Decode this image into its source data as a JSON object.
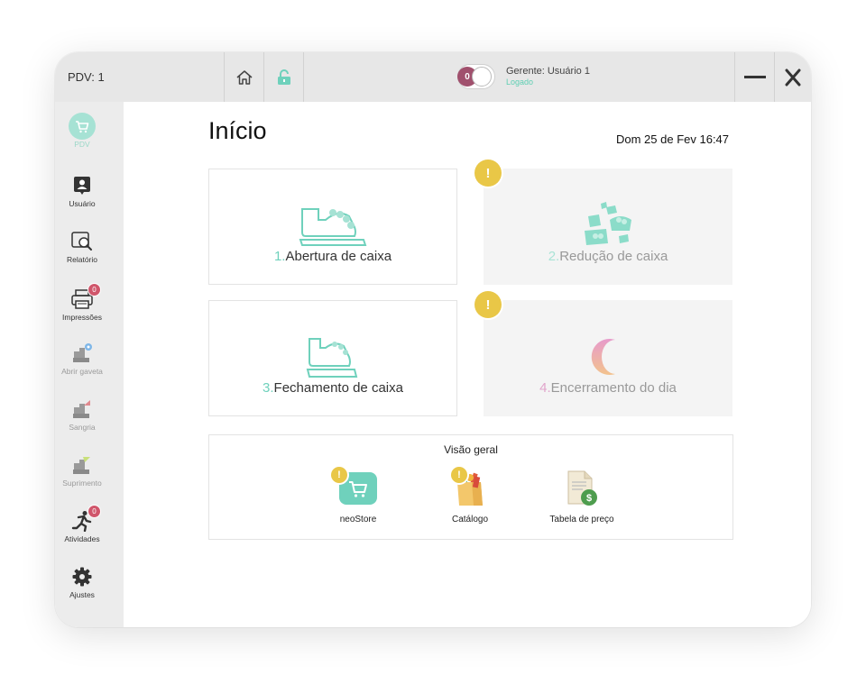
{
  "topbar": {
    "pdv_label": "PDV: 1",
    "toggle_count": "0",
    "user_name": "Gerente: Usuário 1",
    "user_status": "Logado"
  },
  "sidebar": {
    "items": [
      {
        "label": "PDV"
      },
      {
        "label": "Usuário"
      },
      {
        "label": "Relatório"
      },
      {
        "label": "Impressões",
        "badge": "0"
      },
      {
        "label": "Abrir gaveta"
      },
      {
        "label": "Sangria"
      },
      {
        "label": "Suprimento"
      },
      {
        "label": "Atividades",
        "badge": "0"
      },
      {
        "label": "Ajustes"
      }
    ]
  },
  "main": {
    "title": "Início",
    "date": "Dom 25 de Fev 16:47",
    "cards": [
      {
        "num": "1.",
        "label": "Abertura de caixa"
      },
      {
        "num": "2.",
        "label": "Redução de caixa",
        "warning": "!"
      },
      {
        "num": "3.",
        "label": "Fechamento de caixa"
      },
      {
        "num": "4.",
        "label": "Encerramento do dia",
        "warning": "!"
      }
    ],
    "overview": {
      "title": "Visão geral",
      "items": [
        {
          "label": "neoStore",
          "warning": "!"
        },
        {
          "label": "Catálogo",
          "warning": "!"
        },
        {
          "label": "Tabela de preço"
        }
      ]
    }
  },
  "colors": {
    "accent": "#6fd1bc",
    "warning": "#e9c747",
    "badge": "#d0566b",
    "toggle": "#a0506d"
  },
  "icons": [
    "home-icon",
    "unlock-icon",
    "minimize-icon",
    "close-icon",
    "cart-icon",
    "user-icon",
    "report-icon",
    "printer-icon",
    "cash-drawer-icon",
    "activities-icon",
    "gear-icon",
    "cash-register-icon",
    "moon-icon",
    "price-table-icon",
    "catalog-icon"
  ]
}
